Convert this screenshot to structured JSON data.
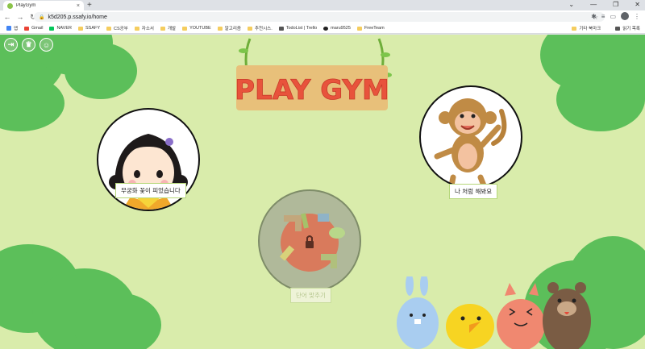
{
  "browser": {
    "tab_title": "PlayGym",
    "tab_close": "×",
    "new_tab": "+",
    "url": "k5d205.p.ssafy.io/home",
    "window_controls": [
      "⌄",
      "—",
      "❐",
      "✕"
    ]
  },
  "bookmarks": {
    "items": [
      {
        "label": "앱",
        "icon": "apps-icon"
      },
      {
        "label": "Gmail",
        "icon": "gmail-icon"
      },
      {
        "label": "NAVER",
        "icon": "naver-icon"
      },
      {
        "label": "SSAFY",
        "icon": "folder-icon"
      },
      {
        "label": "CS공부",
        "icon": "folder-icon"
      },
      {
        "label": "자소서",
        "icon": "folder-icon"
      },
      {
        "label": "개발",
        "icon": "folder-icon"
      },
      {
        "label": "YOUTUBE",
        "icon": "folder-icon"
      },
      {
        "label": "알고리즘",
        "icon": "folder-icon"
      },
      {
        "label": "추천시스.",
        "icon": "folder-icon"
      },
      {
        "label": "TodoList | Trello",
        "icon": "trello-icon"
      },
      {
        "label": "maru9525",
        "icon": "github-icon"
      },
      {
        "label": "FreeTeam",
        "icon": "folder-icon"
      }
    ],
    "other": "기타 북마크",
    "reading_list": "읽기 목록"
  },
  "page": {
    "logo_text": "PLAY GYM",
    "games": [
      {
        "caption": "무궁화 꽃이 피었습니다",
        "locked": false
      },
      {
        "caption": "나 처럼 해봐요",
        "locked": false
      },
      {
        "caption": "단어 맞추기",
        "locked": true
      }
    ],
    "colors": {
      "background": "#d9ecab",
      "bush": "#5cbf5a",
      "sign": "#e8c07a"
    }
  }
}
